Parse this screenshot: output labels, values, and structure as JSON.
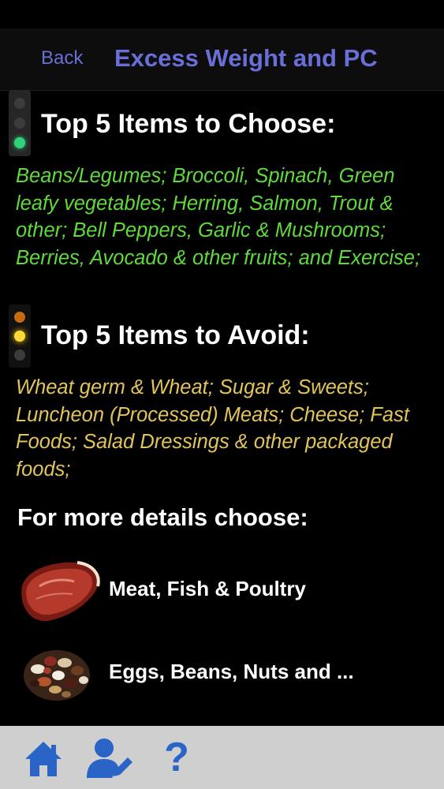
{
  "nav": {
    "back_label": "Back",
    "title": "Excess Weight and PC"
  },
  "choose": {
    "heading": "Top 5 Items to Choose:",
    "text": "Beans/Legumes; Broccoli, Spinach, Green leafy vegetables; Herring, Salmon, Trout & other; Bell Peppers, Garlic & Mushrooms; Berries, Avocado & other fruits; and Exercise;",
    "color": "#5fd93c"
  },
  "avoid": {
    "heading": "Top 5 Items to Avoid:",
    "text": "Wheat germ & Wheat; Sugar & Sweets; Luncheon (Processed) Meats; Cheese; Fast Foods; Salad Dressings & other packaged foods;",
    "color": "#e2c45a"
  },
  "details": {
    "heading": "For more details choose:",
    "items": [
      {
        "label": "Meat, Fish & Poultry",
        "icon": "steak-icon"
      },
      {
        "label": "Eggs, Beans, Nuts and ...",
        "icon": "beans-icon"
      }
    ]
  },
  "tab_bar": {
    "icons": [
      "home-icon",
      "profile-edit-icon",
      "help-icon"
    ],
    "help_glyph": "?",
    "accent": "#2a64c6"
  },
  "colors": {
    "nav_accent": "#6a6fd8",
    "background": "#000000"
  }
}
